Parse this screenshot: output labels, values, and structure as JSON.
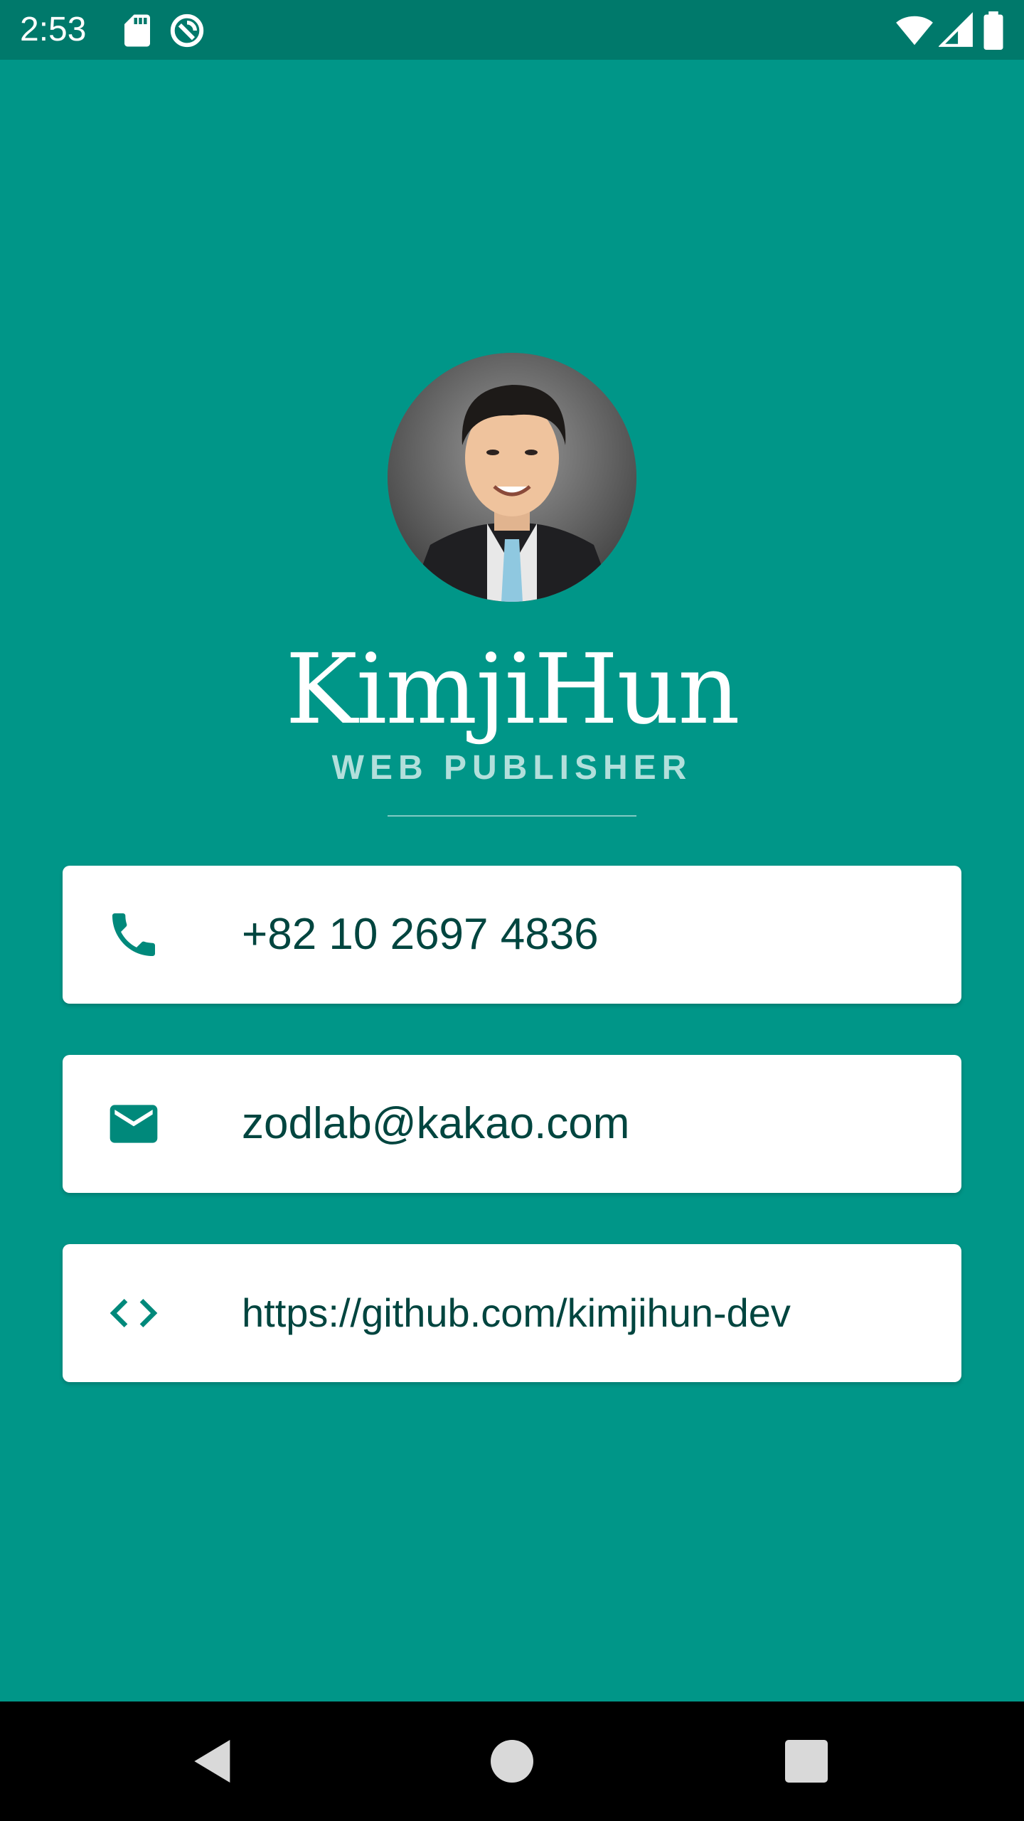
{
  "status_bar": {
    "time": "2:53",
    "left_icons": [
      "sd-card-icon",
      "sync-icon"
    ],
    "right_icons": [
      "wifi-icon",
      "cell-signal-icon",
      "battery-icon"
    ]
  },
  "profile": {
    "name": "KimjiHun",
    "title": "WEB PUBLISHER",
    "avatar_icon": "profile-photo"
  },
  "contacts": [
    {
      "icon": "phone-icon",
      "text": "+82 10 2697 4836"
    },
    {
      "icon": "email-icon",
      "text": "zodlab@kakao.com"
    },
    {
      "icon": "code-icon",
      "text": "https://github.com/kimjihun-dev"
    }
  ],
  "nav_bar": {
    "buttons": [
      "back-icon",
      "home-icon",
      "recents-icon"
    ]
  },
  "colors": {
    "background": "#009688",
    "status_bar": "#00796b",
    "accent_text": "#00453f",
    "icon": "#00897b",
    "subtitle": "#b2dfdb"
  }
}
